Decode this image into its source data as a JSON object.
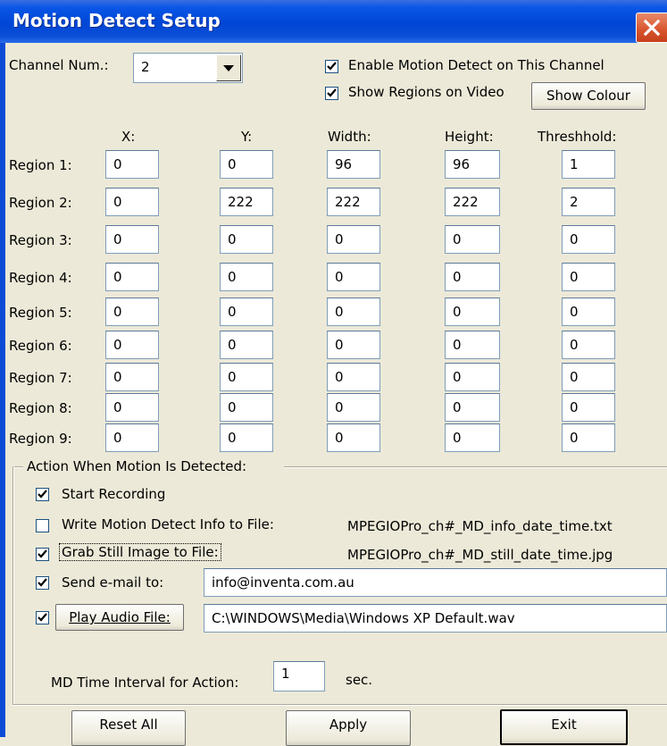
{
  "window": {
    "title": "Motion Detect Setup"
  },
  "channel": {
    "label": "Channel Num.:",
    "value": "2"
  },
  "options": {
    "enable_label": "Enable Motion Detect on This Channel",
    "enable_checked": true,
    "show_regions_label": "Show Regions on Video",
    "show_regions_checked": true,
    "show_colour_button": "Show Colour"
  },
  "columns": [
    "X:",
    "Y:",
    "Width:",
    "Height:",
    "Threshhold:"
  ],
  "regions": [
    {
      "label": "Region 1:",
      "values": [
        "0",
        "0",
        "96",
        "96",
        "1"
      ]
    },
    {
      "label": "Region 2:",
      "values": [
        "0",
        "222",
        "222",
        "222",
        "2"
      ]
    },
    {
      "label": "Region 3:",
      "values": [
        "0",
        "0",
        "0",
        "0",
        "0"
      ]
    },
    {
      "label": "Region 4:",
      "values": [
        "0",
        "0",
        "0",
        "0",
        "0"
      ]
    },
    {
      "label": "Region 5:",
      "values": [
        "0",
        "0",
        "0",
        "0",
        "0"
      ]
    },
    {
      "label": "Region 6:",
      "values": [
        "0",
        "0",
        "0",
        "0",
        "0"
      ]
    },
    {
      "label": "Region 7:",
      "values": [
        "0",
        "0",
        "0",
        "0",
        "0"
      ]
    },
    {
      "label": "Region 8:",
      "values": [
        "0",
        "0",
        "0",
        "0",
        "0"
      ]
    },
    {
      "label": "Region 9:",
      "values": [
        "0",
        "0",
        "0",
        "0",
        "0"
      ]
    }
  ],
  "actions": {
    "group_label": "Action When Motion Is Detected:",
    "start_recording": {
      "label": "Start Recording",
      "checked": true
    },
    "write_info": {
      "label": "Write Motion Detect Info to File:",
      "checked": false,
      "filename": "MPEGIOPro_ch#_MD_info_date_time.txt"
    },
    "grab_still": {
      "label": "Grab Still Image to File:",
      "checked": true,
      "filename": "MPEGIOPro_ch#_MD_still_date_time.jpg"
    },
    "send_email": {
      "label": "Send e-mail to:",
      "checked": true,
      "value": "info@inventa.com.au"
    },
    "play_audio": {
      "label": "Play Audio File:",
      "checked": true,
      "value": "C:\\WINDOWS\\Media\\Windows XP Default.wav"
    },
    "interval_label": "MD Time Interval for Action:",
    "interval_value": "1",
    "interval_unit": "sec."
  },
  "buttons": {
    "reset": "Reset All",
    "apply": "Apply",
    "exit": "Exit"
  }
}
